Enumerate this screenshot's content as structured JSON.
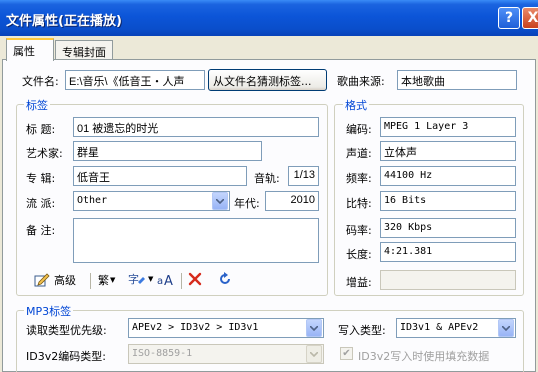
{
  "window": {
    "title": "文件属性(正在播放)",
    "help_label": "?",
    "close_label": "X"
  },
  "tabs": [
    {
      "label": "属性",
      "active": true
    },
    {
      "label": "专辑封面",
      "active": false
    }
  ],
  "file": {
    "filename_label": "文件名:",
    "filename_value": "E:\\音乐\\《低音王・人声",
    "guess_button": "从文件名猜测标签...",
    "source_label": "歌曲来源:",
    "source_value": "本地歌曲"
  },
  "tag_group": {
    "legend": "标签",
    "title_label": "标  题:",
    "title_value": "01 被遗忘的时光",
    "artist_label": "艺术家:",
    "artist_value": "群星",
    "album_label": "专  辑:",
    "album_value": "低音王",
    "track_label": "音轨:",
    "track_value": "1/13",
    "genre_label": "流  派:",
    "genre_value": "Other",
    "year_label": "年代:",
    "year_value": "2010",
    "comment_label": "备  注:",
    "comment_value": ""
  },
  "toolbar": {
    "advanced_label": "高级",
    "traditional_label": "繁",
    "icons": [
      "edit-icon",
      "convert-icon",
      "font-case-icon",
      "delete-icon",
      "refresh-icon"
    ]
  },
  "format_group": {
    "legend": "格式",
    "encoding_label": "编码:",
    "encoding_value": "MPEG 1 Layer 3",
    "channel_label": "声道:",
    "channel_value": "立体声",
    "frequency_label": "频率:",
    "frequency_value": "44100 Hz",
    "bits_label": "比特:",
    "bits_value": "16 Bits",
    "bitrate_label": "码率:",
    "bitrate_value": "320 Kbps",
    "length_label": "长度:",
    "length_value": "4:21.381",
    "gain_label": "增益:",
    "gain_value": ""
  },
  "mp3_group": {
    "legend": "MP3标签",
    "read_priority_label": "读取类型优先级:",
    "read_priority_value": "APEv2 > ID3v2 > ID3v1",
    "write_type_label": "写入类型:",
    "write_type_value": "ID3v1 & APEv2",
    "id3v2_encoding_label": "ID3v2编码类型:",
    "id3v2_encoding_value": "ISO-8859-1",
    "fill_checkbox_label": "ID3v2写入时使用填充数据",
    "fill_checkbox_checked": true
  },
  "colors": {
    "titlebar": "#0a4ecb",
    "group_legend": "#0046d5",
    "window_bg": "#ece9d8"
  }
}
